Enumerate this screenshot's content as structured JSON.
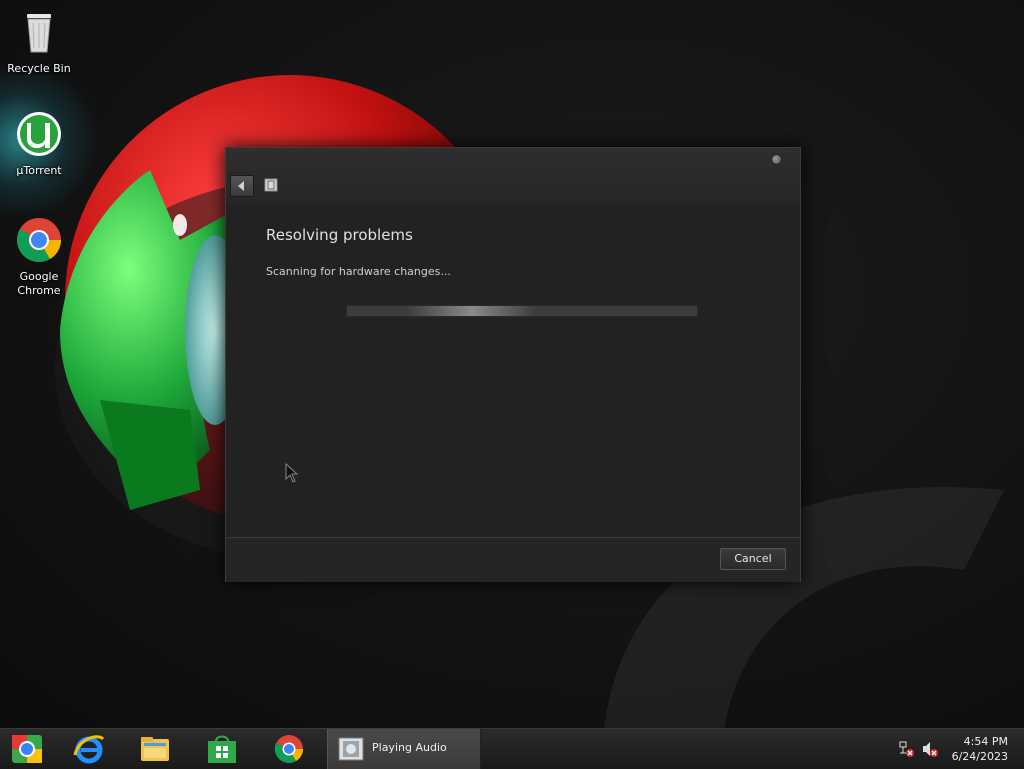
{
  "desktop": {
    "icons": [
      {
        "label": "Recycle Bin",
        "icon": "recycle-bin-icon"
      },
      {
        "label": "µTorrent",
        "icon": "utorrent-icon"
      },
      {
        "label": "Google Chrome",
        "icon": "chrome-icon"
      }
    ]
  },
  "dialog": {
    "title": "Resolving problems",
    "status": "Scanning for hardware changes...",
    "progress": "indeterminate",
    "cancel_label": "Cancel"
  },
  "taskbar": {
    "pinned": [
      "chrome-icon",
      "internet-explorer-icon",
      "file-explorer-icon",
      "store-icon",
      "chrome-icon"
    ],
    "active_task": {
      "label": "Playing Audio",
      "icon": "troubleshooter-icon"
    },
    "tray": [
      "network-error-icon",
      "speaker-muted-icon"
    ],
    "time": "4:54 PM",
    "date": "6/24/2023"
  },
  "colors": {
    "dialog_bg": "#222222",
    "taskbar_bg": "#1a1a1a",
    "wallpaper_red": "#d81818",
    "wallpaper_green": "#22c43a"
  }
}
